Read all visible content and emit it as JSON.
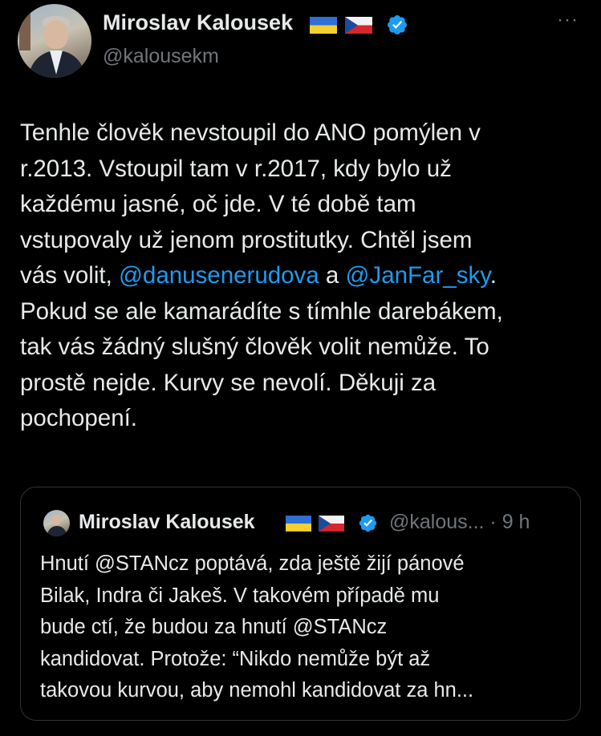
{
  "author": {
    "name": "Miroslav Kalousek",
    "handle": "@kalousekm",
    "flags": [
      "ukraine-flag",
      "czech-flag"
    ],
    "verified_color": "#1d9bf0"
  },
  "more_label": "···",
  "tweet": {
    "line1": "Tenhle člověk nevstoupil do ANO pomýlen v",
    "line2": "r.2013. Vstoupil tam v r.2017, kdy bylo už",
    "line3": "každému jasné, oč jde. V té době tam",
    "line4": "vstupovaly už jenom prostitutky. Chtěl jsem",
    "line5_a": "vás volit, ",
    "mention1": "@danusenerudova",
    "line5_b": " a ",
    "mention2": "@JanFar_sky",
    "line5_c": ".",
    "line6": "Pokud se ale kamarádíte s tímhle darebákem,",
    "line7": "tak vás žádný slušný člověk volit nemůže. To",
    "line8": "prostě nejde. Kurvy se nevolí. Děkuji za",
    "line9": "pochopení."
  },
  "quote": {
    "name": "Miroslav Kalousek",
    "handle_time": "@kalous... · 9 h",
    "line1": "Hnutí @STANcz poptává, zda ještě žijí pánové",
    "line2": "Bilak, Indra či Jakeš. V takovém případě mu",
    "line3": "bude ctí, že budou za hnutí @STANcz",
    "line4": "kandidovat. Protože: “Nikdo nemůže být až",
    "line5": "takovou kurvou, aby nemohl kandidovat za hn..."
  },
  "colors": {
    "background": "#000000",
    "text": "#e7e9ea",
    "secondary": "#71767b",
    "link": "#1d9bf0",
    "border": "#2f3336"
  }
}
